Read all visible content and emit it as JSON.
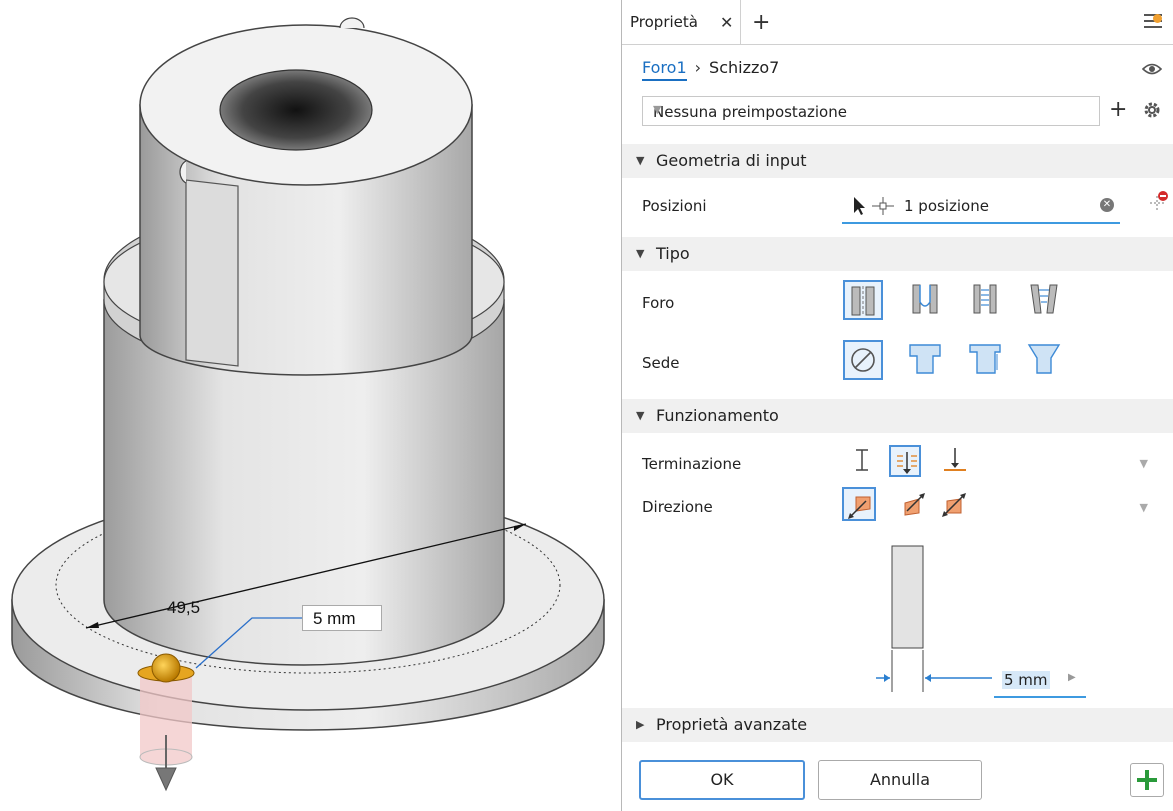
{
  "viewport": {
    "diameter_label": "49,5",
    "depth_input": "5 mm"
  },
  "panel": {
    "tab_label": "Proprietà",
    "breadcrumb": {
      "feature": "Foro1",
      "sketch": "Schizzo7"
    },
    "preset": "Nessuna preimpostazione",
    "sections": {
      "input_geometry": "Geometria di input",
      "type": "Tipo",
      "behavior": "Funzionamento",
      "advanced": "Proprietà avanzate"
    },
    "positions": {
      "label": "Posizioni",
      "value": "1 posizione"
    },
    "hole_label": "Foro",
    "seat_label": "Sede",
    "termination_label": "Terminazione",
    "direction_label": "Direzione",
    "diameter_value": "5 mm",
    "ok_label": "OK",
    "cancel_label": "Annulla"
  }
}
